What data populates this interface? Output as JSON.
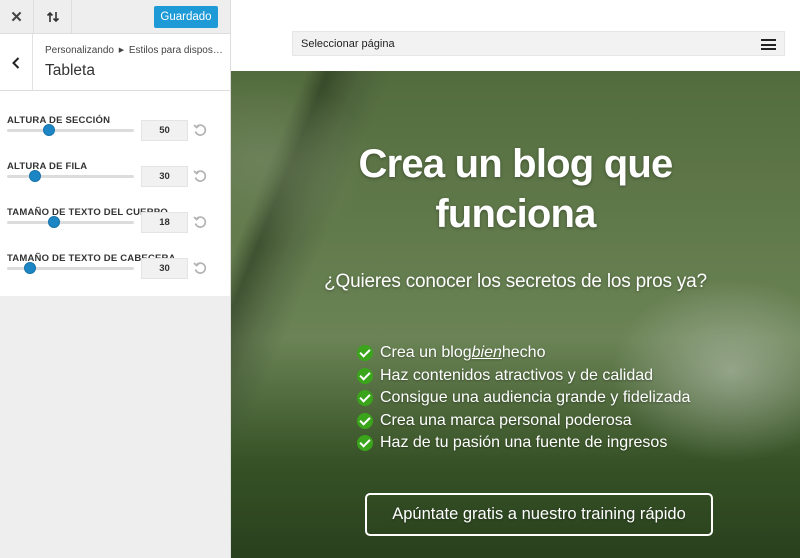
{
  "topbar": {
    "close_icon": "close-icon",
    "swap_icon": "sort-arrows-icon",
    "saved_label": "Guardado"
  },
  "section": {
    "breadcrumb_root": "Personalizando",
    "breadcrumb_parent": "Estilos para dispos…",
    "title": "Tableta"
  },
  "controls": [
    {
      "label": "ALTURA DE SECCIÓN",
      "value": "50",
      "level": 0.33
    },
    {
      "label": "ALTURA DE FILA",
      "value": "30",
      "level": 0.22
    },
    {
      "label": "TAMAÑO DE TEXTO DEL CUERPO",
      "value": "18",
      "level": 0.37
    },
    {
      "label": "TAMAÑO DE TEXTO DE CABECERA",
      "value": "30",
      "level": 0.18
    }
  ],
  "preview": {
    "page_select_label": "Seleccionar página",
    "hero_title_line1": "Crea un blog que",
    "hero_title_line2": "funciona",
    "hero_subtitle": "¿Quieres conocer los secretos de los pros ya?",
    "checklist": [
      {
        "pre": "Crea un blog ",
        "emph": "bien",
        "post": " hecho"
      },
      {
        "pre": "Haz contenidos atractivos y de calidad",
        "emph": "",
        "post": ""
      },
      {
        "pre": "Consigue una audiencia grande y fidelizada",
        "emph": "",
        "post": ""
      },
      {
        "pre": "Crea una marca personal poderosa",
        "emph": "",
        "post": ""
      },
      {
        "pre": "Haz de tu pasión una fuente de ingresos",
        "emph": "",
        "post": ""
      }
    ],
    "cta_label": "Apúntate gratis a nuestro training rápido"
  },
  "colors": {
    "accent": "#1e9ad6",
    "slider": "#1c86c4",
    "check": "#3aa51b"
  }
}
